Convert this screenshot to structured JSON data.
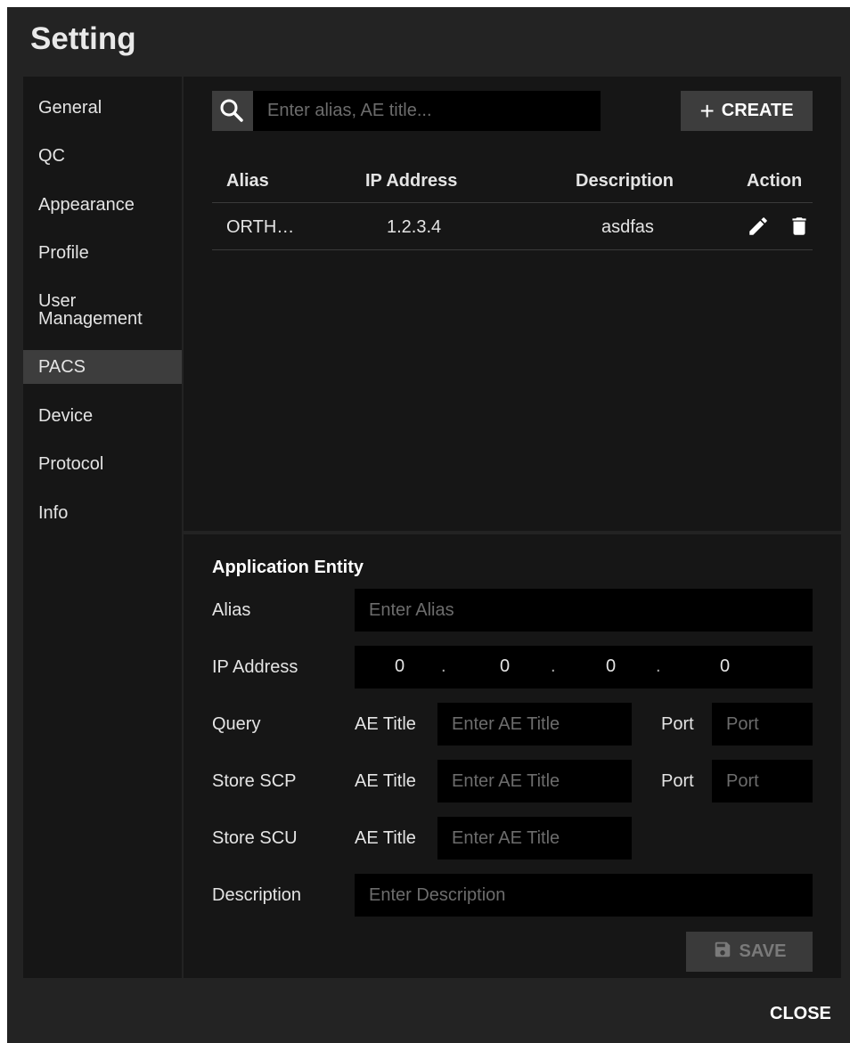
{
  "dialog": {
    "title": "Setting"
  },
  "sidebar": {
    "items": [
      {
        "label": "General"
      },
      {
        "label": "QC"
      },
      {
        "label": "Appearance"
      },
      {
        "label": "Profile"
      },
      {
        "label": "User Management"
      },
      {
        "label": "PACS",
        "active": true
      },
      {
        "label": "Device"
      },
      {
        "label": "Protocol"
      },
      {
        "label": "Info"
      }
    ]
  },
  "search": {
    "placeholder": "Enter alias, AE title...",
    "icon": "search-icon"
  },
  "toolbar": {
    "create_label": "CREATE",
    "create_icon": "plus-icon"
  },
  "table": {
    "columns": [
      "Alias",
      "IP Address",
      "Description",
      "Action"
    ],
    "rows": [
      {
        "alias": "ORTH…",
        "ip": "1.2.3.4",
        "description": "asdfas",
        "actions": [
          "edit-icon",
          "delete-icon"
        ]
      }
    ]
  },
  "form": {
    "section_title": "Application Entity",
    "alias": {
      "label": "Alias",
      "placeholder": "Enter Alias"
    },
    "ip": {
      "label": "IP Address",
      "octets": [
        "0",
        "0",
        "0",
        "0"
      ],
      "separator": "."
    },
    "query": {
      "label": "Query",
      "ae_label": "AE Title",
      "ae_placeholder": "Enter AE Title",
      "port_label": "Port",
      "port_placeholder": "Port"
    },
    "store_scp": {
      "label": "Store SCP",
      "ae_label": "AE Title",
      "ae_placeholder": "Enter AE Title",
      "port_label": "Port",
      "port_placeholder": "Port"
    },
    "store_scu": {
      "label": "Store SCU",
      "ae_label": "AE Title",
      "ae_placeholder": "Enter AE Title"
    },
    "description": {
      "label": "Description",
      "placeholder": "Enter Description"
    },
    "save_label": "SAVE"
  },
  "footer": {
    "close_label": "CLOSE"
  },
  "colors": {
    "dialog_bg": "#232323",
    "panel_bg": "#161616",
    "active_bg": "#3d3d3d",
    "input_bg": "#000000"
  }
}
